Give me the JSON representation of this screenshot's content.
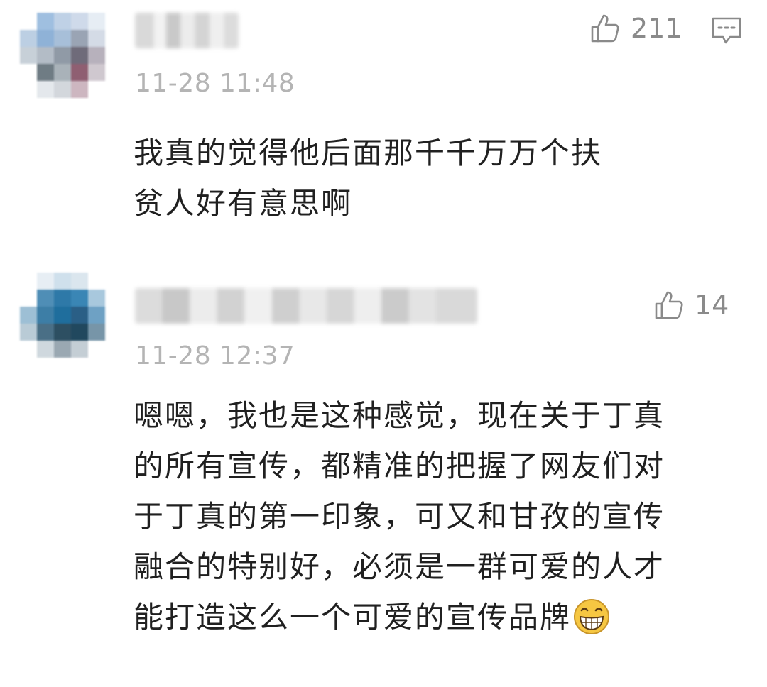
{
  "comments": [
    {
      "likes": "211",
      "timestamp": "11-28 11:48",
      "content_lines": [
        "我真的觉得他后面那千千万万个扶",
        "贫人好有意思啊"
      ]
    },
    {
      "likes": "14",
      "timestamp": "11-28 12:37",
      "content_lines": [
        "嗯嗯，我也是这种感觉，现在关于丁真",
        "的所有宣传，都精准的把握了网友们对",
        "于丁真的第一印象，可又和甘孜的宣传",
        "融合的特别好，必须是一群可爱的人才",
        "能打造这么一个可爱的宣传品牌"
      ],
      "trailing_emoji": "grinning-face-emoji"
    }
  ],
  "icons": {
    "like": "thumbs-up-icon",
    "reply": "comment-bubble-icon"
  },
  "colors": {
    "text": "#202020",
    "meta": "#b4b4b4",
    "icon": "#8a8a8a",
    "emoji_fill": "#f6c742"
  }
}
